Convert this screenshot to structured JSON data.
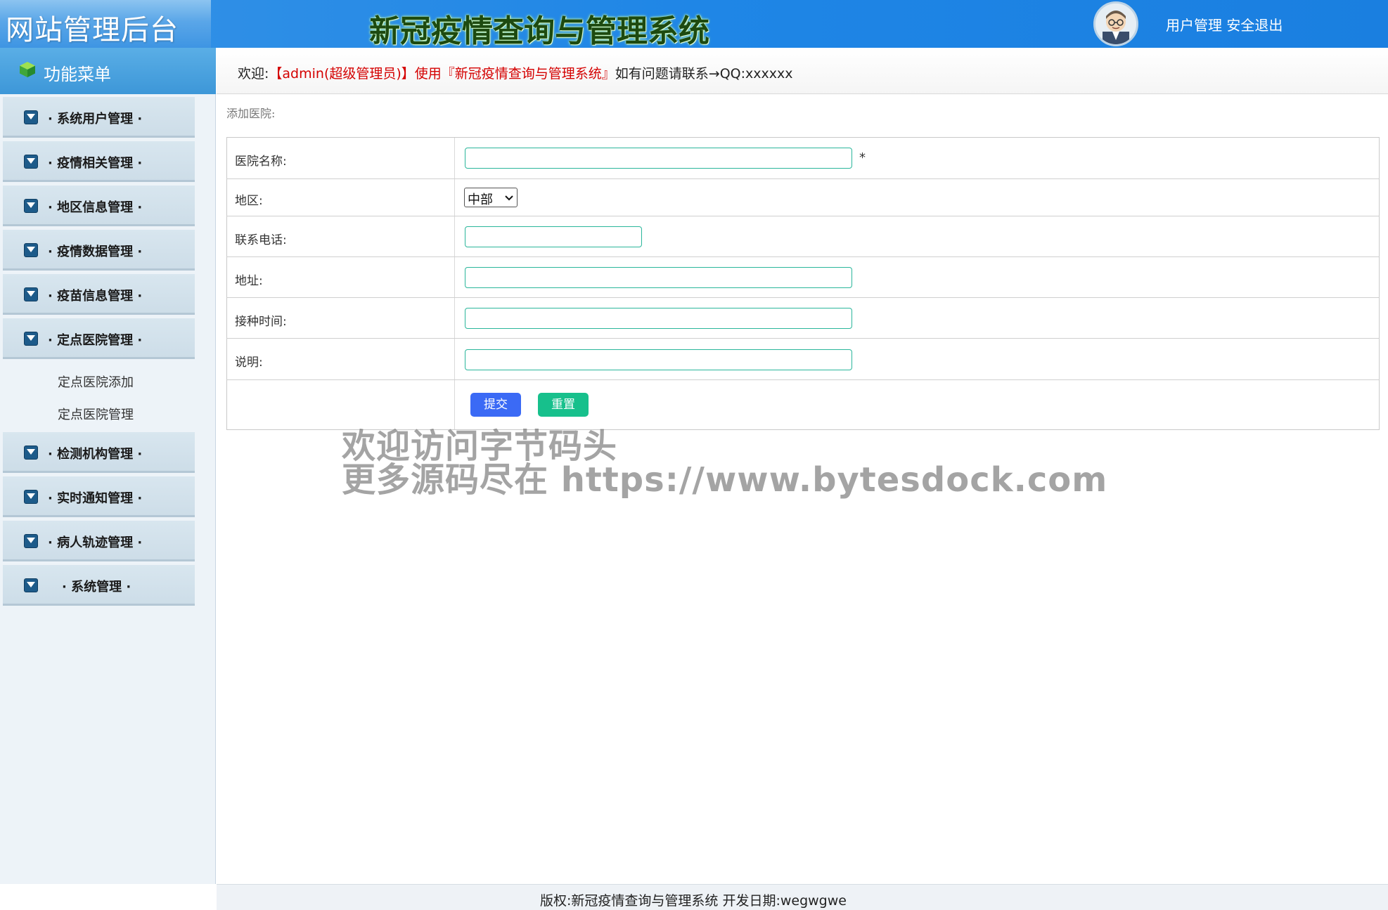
{
  "header": {
    "site_title": "网站管理后台",
    "system_title": "新冠疫情查询与管理系统",
    "user_mgmt_link": "用户管理",
    "logout_link": "安全退出"
  },
  "sidebar": {
    "title": "功能菜单",
    "groups": [
      {
        "label": "· 系统用户管理 ·"
      },
      {
        "label": "· 疫情相关管理 ·"
      },
      {
        "label": "· 地区信息管理 ·"
      },
      {
        "label": "· 疫情数据管理 ·"
      },
      {
        "label": "· 疫苗信息管理 ·"
      },
      {
        "label": "· 定点医院管理 ·",
        "sub_items": [
          "定点医院添加",
          "定点医院管理"
        ]
      },
      {
        "label": "· 检测机构管理 ·"
      },
      {
        "label": "· 实时通知管理 ·"
      },
      {
        "label": "· 病人轨迹管理 ·"
      },
      {
        "label": "· 系统管理 ·"
      }
    ]
  },
  "welcome": {
    "prefix": "欢迎:",
    "user": "【admin(超级管理员)】",
    "use": "使用",
    "system": "『新冠疫情查询与管理系统』",
    "suffix": "如有问题请联系→QQ:xxxxxx"
  },
  "form": {
    "section_title": "添加医院:",
    "fields": [
      {
        "label": "医院名称:",
        "value": "",
        "required_mark": "*"
      },
      {
        "label": "地区:",
        "selected": "中部"
      },
      {
        "label": "联系电话:",
        "value": ""
      },
      {
        "label": "地址:",
        "value": ""
      },
      {
        "label": "接种时间:",
        "value": ""
      },
      {
        "label": "说明:",
        "value": ""
      }
    ],
    "submit_label": "提交",
    "reset_label": "重置"
  },
  "watermark": {
    "line1": "欢迎访问字节码头",
    "line2": "更多源码尽在  https://www.bytesdock.com"
  },
  "footer": {
    "text": "版权:新冠疫情查询与管理系统 开发日期:wegwgwe"
  },
  "colors": {
    "header_blue": "#1f86e6",
    "input_border": "#2ab69b",
    "submit_btn": "#3b6af5",
    "reset_btn": "#17c08c",
    "welcome_red": "#d40000"
  }
}
